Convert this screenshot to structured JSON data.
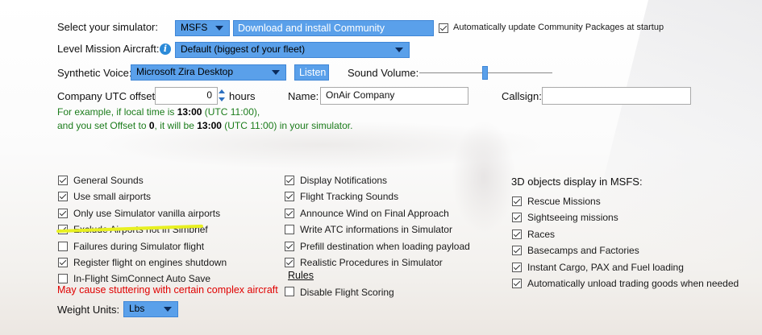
{
  "simulator": {
    "label": "Select your simulator:",
    "selected": "MSFS",
    "download_button": "Download and install Community Packages",
    "auto_update_label": "Automatically update Community Packages at startup",
    "auto_update_checked": true
  },
  "level_mission": {
    "label": "Level Mission Aircraft:",
    "selected": "Default (biggest of your fleet)"
  },
  "voice": {
    "label": "Synthetic Voice:",
    "selected": "Microsoft Zira Desktop",
    "listen_button": "Listen",
    "sound_volume_label": "Sound Volume:",
    "sound_volume": 0.49
  },
  "utc": {
    "label": "Company UTC offset:",
    "value": "0",
    "unit": "hours",
    "name_label": "Name:",
    "name_value": "OnAir Company",
    "callsign_label": "Callsign:",
    "callsign_value": ""
  },
  "example": {
    "l1_pre": "For example, if local time is ",
    "l1_bold": "13:00",
    "l1_post": " (UTC 11:00),",
    "l2_pre": "and you set Offset to ",
    "l2_bold1": "0",
    "l2_mid": ", it will be ",
    "l2_bold2": "13:00",
    "l2_post": " (UTC 11:00) in your simulator."
  },
  "col1": [
    {
      "label": "General Sounds",
      "checked": true
    },
    {
      "label": "Use small airports",
      "checked": true
    },
    {
      "label": "Only use Simulator vanilla airports",
      "checked": true
    },
    {
      "label": "Exclude Airports not in Simbrief",
      "checked": true
    },
    {
      "label": "Failures during Simulator flight",
      "checked": false
    },
    {
      "label": "Register flight on engines shutdown",
      "checked": true
    },
    {
      "label": "In-Flight SimConnect Auto Save",
      "checked": false
    }
  ],
  "warning": "May cause stuttering with certain complex aircraft",
  "col2": [
    {
      "label": "Display Notifications",
      "checked": true
    },
    {
      "label": "Flight Tracking Sounds",
      "checked": true
    },
    {
      "label": "Announce Wind on Final Approach",
      "checked": true
    },
    {
      "label": "Write ATC informations in Simulator",
      "checked": false
    },
    {
      "label": "Prefill destination when loading payload",
      "checked": true
    },
    {
      "label": "Realistic Procedures in Simulator",
      "checked": true
    }
  ],
  "rules_link": "Rules",
  "disable_scoring": {
    "label": "Disable Flight Scoring",
    "checked": false
  },
  "col3": {
    "title": "3D objects display in MSFS:",
    "items": [
      {
        "label": "Rescue Missions",
        "checked": true
      },
      {
        "label": "Sightseeing missions",
        "checked": true
      },
      {
        "label": "Races",
        "checked": true
      },
      {
        "label": "Basecamps and Factories",
        "checked": true
      },
      {
        "label": "Instant Cargo, PAX and Fuel loading",
        "checked": true
      },
      {
        "label": "Automatically unload trading goods when needed",
        "checked": true
      }
    ]
  },
  "weight": {
    "label": "Weight Units:",
    "selected": "Lbs"
  }
}
